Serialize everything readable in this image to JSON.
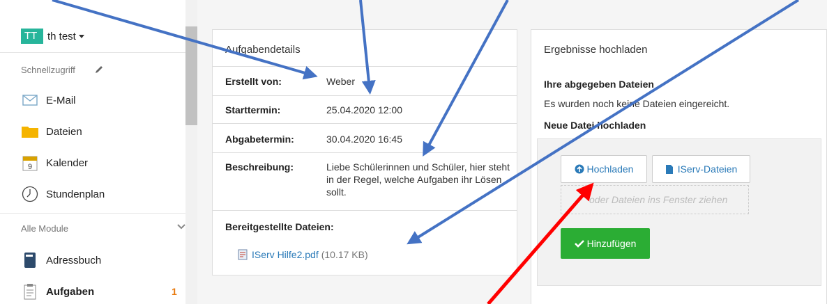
{
  "user": {
    "initials": "TT",
    "name": "th test"
  },
  "sidebar": {
    "quick_access_label": "Schnellzugriff",
    "all_modules_label": "Alle Module",
    "quick_items": [
      {
        "label": "E-Mail",
        "icon": "envelope-icon"
      },
      {
        "label": "Dateien",
        "icon": "folder-icon"
      },
      {
        "label": "Kalender",
        "icon": "calendar-icon"
      },
      {
        "label": "Stundenplan",
        "icon": "clock-icon"
      }
    ],
    "module_items": [
      {
        "label": "Adressbuch",
        "icon": "address-book-icon"
      },
      {
        "label": "Aufgaben",
        "icon": "clipboard-icon",
        "badge": "1"
      }
    ]
  },
  "details": {
    "title": "Aufgabendetails",
    "rows": [
      {
        "label": "Erstellt von:",
        "value": "Weber"
      },
      {
        "label": "Starttermin:",
        "value": "25.04.2020 12:00"
      },
      {
        "label": "Abgabetermin:",
        "value": "30.04.2020 16:45"
      },
      {
        "label": "Beschreibung:",
        "value": "Liebe Schülerinnen und Schüler, hier steht in der Regel, welche Aufgaben ihr Lösen sollt."
      }
    ],
    "files_label": "Bereitgestellte Dateien:",
    "file": {
      "name": "IServ Hilfe2.pdf",
      "size": "(10.17 KB)"
    }
  },
  "upload": {
    "title": "Ergebnisse hochladen",
    "submitted_heading": "Ihre abgegeben Dateien",
    "submitted_text": "Es wurden noch keine Dateien eingereicht.",
    "new_file_heading": "Neue Datei hochladen",
    "upload_button": "Hochladen",
    "iserv_button": "IServ-Dateien",
    "drop_text": "oder Dateien ins Fenster ziehen",
    "add_button": "Hinzufügen"
  },
  "colors": {
    "avatar": "#27b59b",
    "link": "#2a7ab8",
    "add_button": "#2bad34",
    "badge": "#e8790c",
    "arrow_blue": "#4472c4",
    "arrow_red": "#ff0000"
  }
}
